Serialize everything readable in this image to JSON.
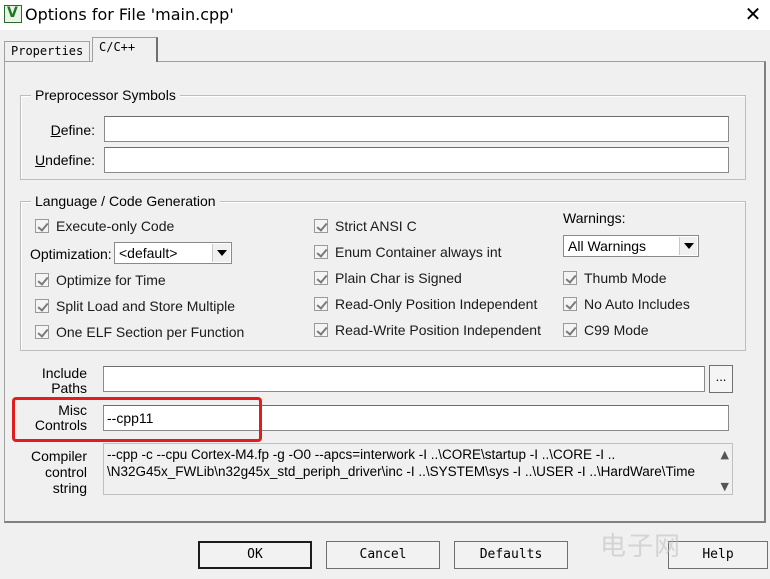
{
  "window": {
    "icon_glyph": "V",
    "title": "Options for File 'main.cpp'",
    "close_glyph": "✕"
  },
  "tabs": [
    {
      "label": "Properties"
    },
    {
      "label": "C/C++",
      "active": true
    }
  ],
  "preprocessor": {
    "group_label": "Preprocessor Symbols",
    "define_label": "Define:",
    "define_value": "",
    "undefine_label": "Undefine:",
    "undefine_value": ""
  },
  "language": {
    "group_label": "Language / Code Generation",
    "execute_only": "Execute-only Code",
    "optimization_label": "Optimization:",
    "optimization_value": "<default>",
    "optimize_for_time": "Optimize for Time",
    "split_load_store": "Split Load and Store Multiple",
    "one_elf_section": "One ELF Section per Function",
    "strict_ansi": "Strict ANSI C",
    "enum_container": "Enum Container always int",
    "plain_char": "Plain Char is Signed",
    "ro_position": "Read-Only Position Independent",
    "rw_position": "Read-Write Position Independent",
    "warnings_label": "Warnings:",
    "warnings_value": "All Warnings",
    "thumb_mode": "Thumb Mode",
    "no_auto_includes": "No Auto Includes",
    "c99_mode": "C99 Mode"
  },
  "include_paths": {
    "label_line1": "Include",
    "label_line2": "Paths",
    "value": "",
    "browse_label": "..."
  },
  "misc_controls": {
    "label_line1": "Misc",
    "label_line2": "Controls",
    "value": "--cpp11"
  },
  "compiler_control": {
    "label_line1": "Compiler",
    "label_line2": "control",
    "label_line3": "string",
    "line1": "--cpp -c --cpu Cortex-M4.fp -g -O0 --apcs=interwork -I ..\\CORE\\startup -I ..\\CORE -I ..",
    "line2": "\\N32G45x_FWLib\\n32g45x_std_periph_driver\\inc -I ..\\SYSTEM\\sys -I ..\\USER -I ..\\HardWare\\Time"
  },
  "buttons": {
    "ok": "OK",
    "cancel": "Cancel",
    "defaults": "Defaults",
    "help": "Help"
  },
  "watermark": "电子网",
  "colors": {
    "highlight": "#e01e1e",
    "dialog_bg": "#f0f0f0"
  }
}
